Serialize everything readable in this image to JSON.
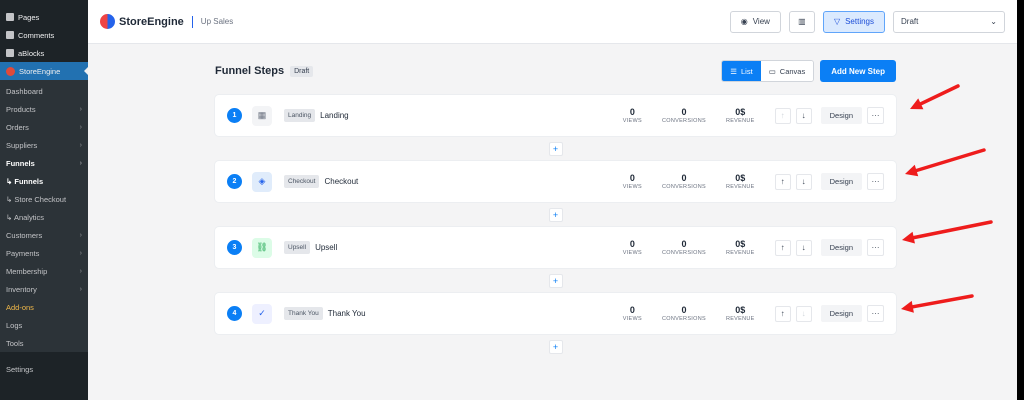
{
  "wp": {
    "top_items": [
      "Pages",
      "Comments",
      "aBlocks",
      "StoreEngine"
    ],
    "menu": [
      {
        "label": "Dashboard",
        "chev": false,
        "style": ""
      },
      {
        "label": "Products",
        "chev": true,
        "style": ""
      },
      {
        "label": "Orders",
        "chev": true,
        "style": ""
      },
      {
        "label": "Suppliers",
        "chev": true,
        "style": ""
      },
      {
        "label": "Funnels",
        "chev": true,
        "style": "bold"
      },
      {
        "label": "↳ Funnels",
        "chev": false,
        "style": "bold"
      },
      {
        "label": "↳ Store Checkout",
        "chev": false,
        "style": ""
      },
      {
        "label": "↳ Analytics",
        "chev": false,
        "style": ""
      },
      {
        "label": "Customers",
        "chev": true,
        "style": ""
      },
      {
        "label": "Payments",
        "chev": true,
        "style": ""
      },
      {
        "label": "Membership",
        "chev": true,
        "style": ""
      },
      {
        "label": "Inventory",
        "chev": true,
        "style": ""
      },
      {
        "label": "Add-ons",
        "chev": false,
        "style": "orange"
      },
      {
        "label": "Logs",
        "chev": false,
        "style": ""
      },
      {
        "label": "Tools",
        "chev": false,
        "style": ""
      }
    ],
    "settings": "Settings"
  },
  "header": {
    "brand": "StoreEngine",
    "crumb": "Up Sales",
    "view_label": "View",
    "settings_label": "Settings",
    "status_value": "Draft"
  },
  "funnel": {
    "title": "Funnel Steps",
    "status_badge": "Draft",
    "list_label": "List",
    "canvas_label": "Canvas",
    "add_step_label": "Add New Step",
    "stat_labels": {
      "views": "VIEWS",
      "conversions": "CONVERSIONS",
      "revenue": "REVENUE"
    },
    "design_label": "Design",
    "steps": [
      {
        "num": "1",
        "type": "Landing",
        "name": "Landing",
        "views": "0",
        "conversions": "0",
        "revenue": "0$",
        "icon": "layout-icon",
        "glyph": "▦",
        "tone": "",
        "up_disabled": true,
        "down_disabled": false
      },
      {
        "num": "2",
        "type": "Checkout",
        "name": "Checkout",
        "views": "0",
        "conversions": "0",
        "revenue": "0$",
        "icon": "tag-icon",
        "glyph": "◈",
        "tone": "blue",
        "up_disabled": false,
        "down_disabled": false
      },
      {
        "num": "3",
        "type": "Upsell",
        "name": "Upsell",
        "views": "0",
        "conversions": "0",
        "revenue": "0$",
        "icon": "link-icon",
        "glyph": "⛓",
        "tone": "green",
        "up_disabled": false,
        "down_disabled": false
      },
      {
        "num": "4",
        "type": "Thank You",
        "name": "Thank You",
        "views": "0",
        "conversions": "0",
        "revenue": "0$",
        "icon": "check-icon",
        "glyph": "✓",
        "tone": "lav",
        "up_disabled": false,
        "down_disabled": true
      }
    ]
  },
  "annotation": {
    "arrow_color": "#ee1c1c"
  }
}
